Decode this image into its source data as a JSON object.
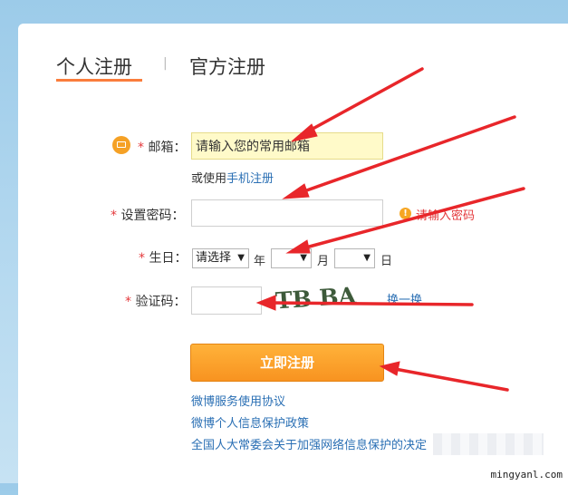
{
  "tabs": {
    "personal": "个人注册",
    "separator": "|",
    "official": "官方注册"
  },
  "form": {
    "required_mark": "*",
    "email_label": "邮箱：",
    "email_value": "请输入您的常用邮箱",
    "alt_prefix": "或使用",
    "alt_link": "手机注册",
    "password_label": "设置密码：",
    "password_hint": "请输入密码",
    "birthday_label": "生日：",
    "year_select": "请选择",
    "year_unit": "年",
    "month_unit": "月",
    "day_unit": "日",
    "captcha_label": "验证码：",
    "captcha_text": "TB BA",
    "refresh_link": "换一换",
    "submit": "立即注册"
  },
  "footer_links": [
    "微博服务使用协议",
    "微博个人信息保护政策",
    "全国人大常委会关于加强网络信息保护的决定"
  ],
  "watermark": "mingyanl.com",
  "colors": {
    "accent": "#fa7d3c",
    "button": "#f89320",
    "link": "#2a6fb4",
    "required": "#e4393c",
    "arrow": "#e8262a"
  }
}
